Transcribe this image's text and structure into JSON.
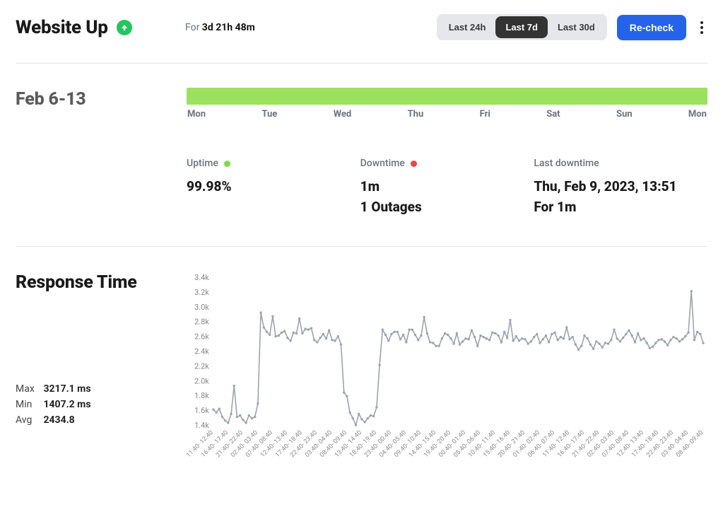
{
  "header": {
    "title": "Website Up",
    "for_prefix": "For ",
    "for_value": "3d 21h 48m",
    "range": {
      "options": [
        "Last 24h",
        "Last 7d",
        "Last 30d"
      ],
      "active_index": 1
    },
    "recheck_label": "Re-check"
  },
  "date_range_section": {
    "title": "Feb 6-13",
    "day_labels": [
      "Mon",
      "Tue",
      "Wed",
      "Thu",
      "Fri",
      "Sat",
      "Sun",
      "Mon"
    ],
    "stats": {
      "uptime": {
        "label": "Uptime",
        "value": "99.98%"
      },
      "downtime": {
        "label": "Downtime",
        "value": "1m",
        "subvalue": "1 Outages"
      },
      "last_downtime": {
        "label": "Last downtime",
        "value": "Thu, Feb 9, 2023, 13:51",
        "subvalue": "For 1m"
      }
    }
  },
  "response_time": {
    "title": "Response Time",
    "summary": {
      "max_label": "Max",
      "max_value": "3217.1 ms",
      "min_label": "Min",
      "min_value": "1407.2 ms",
      "avg_label": "Avg",
      "avg_value": "2434.8"
    }
  },
  "chart_data": {
    "type": "line",
    "ylabel": "",
    "xlabel": "",
    "ylim": [
      1400,
      3400
    ],
    "y_ticks": [
      "3.4k",
      "3.2k",
      "3.0k",
      "2.8k",
      "2.6k",
      "2.4k",
      "2.2k",
      "2.0k",
      "1.8k",
      "1.6k",
      "1.4k"
    ],
    "x_ticks": [
      "11:40- 12:40",
      "16:40- 17:40",
      "21:40- 22:40",
      "02:40- 03:40",
      "07:40- 08:40",
      "12:40- 13:40",
      "17:40- 18:40",
      "22:40- 23:40",
      "03:40- 04:40",
      "08:40- 09:40",
      "13:40- 14:40",
      "18:40- 19:40",
      "23:40- 00:40",
      "04:40- 05:40",
      "09:40- 10:40",
      "14:40- 15:40",
      "19:40- 20:40",
      "00:40- 01:40",
      "05:40- 06:40",
      "10:40- 11:40",
      "15:40- 16:40",
      "20:40- 21:40",
      "01:40- 02:40",
      "06:40- 07:40",
      "11:40- 12:40",
      "16:40- 17:40",
      "21:40- 22:40",
      "02:40- 03:40",
      "07:40- 08:40",
      "12:40- 13:40",
      "17:40- 18:40",
      "22:40- 23:40",
      "03:40- 04:40",
      "08:40- 09:40"
    ],
    "values": [
      1620,
      1580,
      1630,
      1520,
      1470,
      1440,
      1560,
      1940,
      1520,
      1540,
      1480,
      1440,
      1540,
      1500,
      1520,
      1700,
      2930,
      2730,
      2670,
      2630,
      2880,
      2610,
      2620,
      2660,
      2680,
      2590,
      2550,
      2660,
      2650,
      2850,
      2650,
      2710,
      2700,
      2720,
      2560,
      2530,
      2590,
      2640,
      2580,
      2690,
      2560,
      2550,
      2610,
      2500,
      1850,
      1800,
      1580,
      1500,
      1410,
      1560,
      1490,
      1450,
      1500,
      1540,
      1530,
      1650,
      2220,
      2700,
      2630,
      2550,
      2640,
      2670,
      2670,
      2570,
      2630,
      2530,
      2700,
      2700,
      2630,
      2560,
      2620,
      2870,
      2650,
      2530,
      2520,
      2480,
      2480,
      2580,
      2650,
      2630,
      2580,
      2510,
      2650,
      2500,
      2540,
      2580,
      2570,
      2690,
      2600,
      2480,
      2620,
      2600,
      2580,
      2560,
      2660,
      2650,
      2620,
      2530,
      2670,
      2590,
      2830,
      2550,
      2610,
      2550,
      2580,
      2570,
      2510,
      2540,
      2600,
      2640,
      2520,
      2570,
      2620,
      2530,
      2640,
      2660,
      2560,
      2600,
      2580,
      2730,
      2570,
      2600,
      2500,
      2430,
      2480,
      2620,
      2580,
      2500,
      2440,
      2540,
      2510,
      2460,
      2520,
      2510,
      2560,
      2700,
      2580,
      2540,
      2590,
      2640,
      2690,
      2620,
      2530,
      2650,
      2560,
      2580,
      2520,
      2450,
      2470,
      2520,
      2560,
      2570,
      2540,
      2490,
      2560,
      2600,
      2580,
      2540,
      2570,
      2610,
      2660,
      3220,
      2560,
      2670,
      2640,
      2520
    ]
  }
}
